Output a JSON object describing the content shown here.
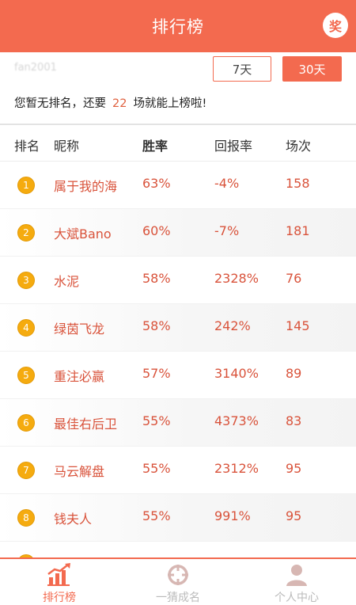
{
  "header": {
    "title": "排行榜",
    "award_label": "奖"
  },
  "user": {
    "name": "fan2001",
    "notice_prefix": "您暂无排名，还要",
    "games_needed": "22",
    "notice_suffix": "场就能上榜啦!"
  },
  "range": {
    "options": [
      "7天",
      "30天"
    ],
    "selected": "30天"
  },
  "columns": {
    "rank": "排名",
    "nickname": "昵称",
    "win_rate": "胜率",
    "return_rate": "回报率",
    "games": "场次"
  },
  "rows": [
    {
      "rank": "1",
      "nickname": "属于我的海",
      "win_rate": "63%",
      "return_rate": "-4%",
      "games": "158"
    },
    {
      "rank": "2",
      "nickname": "大斌Bano",
      "win_rate": "60%",
      "return_rate": "-7%",
      "games": "181"
    },
    {
      "rank": "3",
      "nickname": "水泥",
      "win_rate": "58%",
      "return_rate": "2328%",
      "games": "76"
    },
    {
      "rank": "4",
      "nickname": "绿茵飞龙",
      "win_rate": "58%",
      "return_rate": "242%",
      "games": "145"
    },
    {
      "rank": "5",
      "nickname": "重注必赢",
      "win_rate": "57%",
      "return_rate": "3140%",
      "games": "89"
    },
    {
      "rank": "6",
      "nickname": "最佳右后卫",
      "win_rate": "55%",
      "return_rate": "4373%",
      "games": "83"
    },
    {
      "rank": "7",
      "nickname": "马云解盘",
      "win_rate": "55%",
      "return_rate": "2312%",
      "games": "95"
    },
    {
      "rank": "8",
      "nickname": "钱夫人",
      "win_rate": "55%",
      "return_rate": "991%",
      "games": "95"
    }
  ],
  "nav": {
    "items": [
      {
        "label": "排行榜",
        "icon": "bar-chart-icon"
      },
      {
        "label": "一猜成名",
        "icon": "crosshair-icon"
      },
      {
        "label": "个人中心",
        "icon": "user-icon"
      }
    ],
    "active": "排行榜"
  },
  "colors": {
    "accent": "#f36a4f",
    "value_text": "#d9533b",
    "medal": "#f5ab0f",
    "inactive": "#bbbbbb"
  }
}
